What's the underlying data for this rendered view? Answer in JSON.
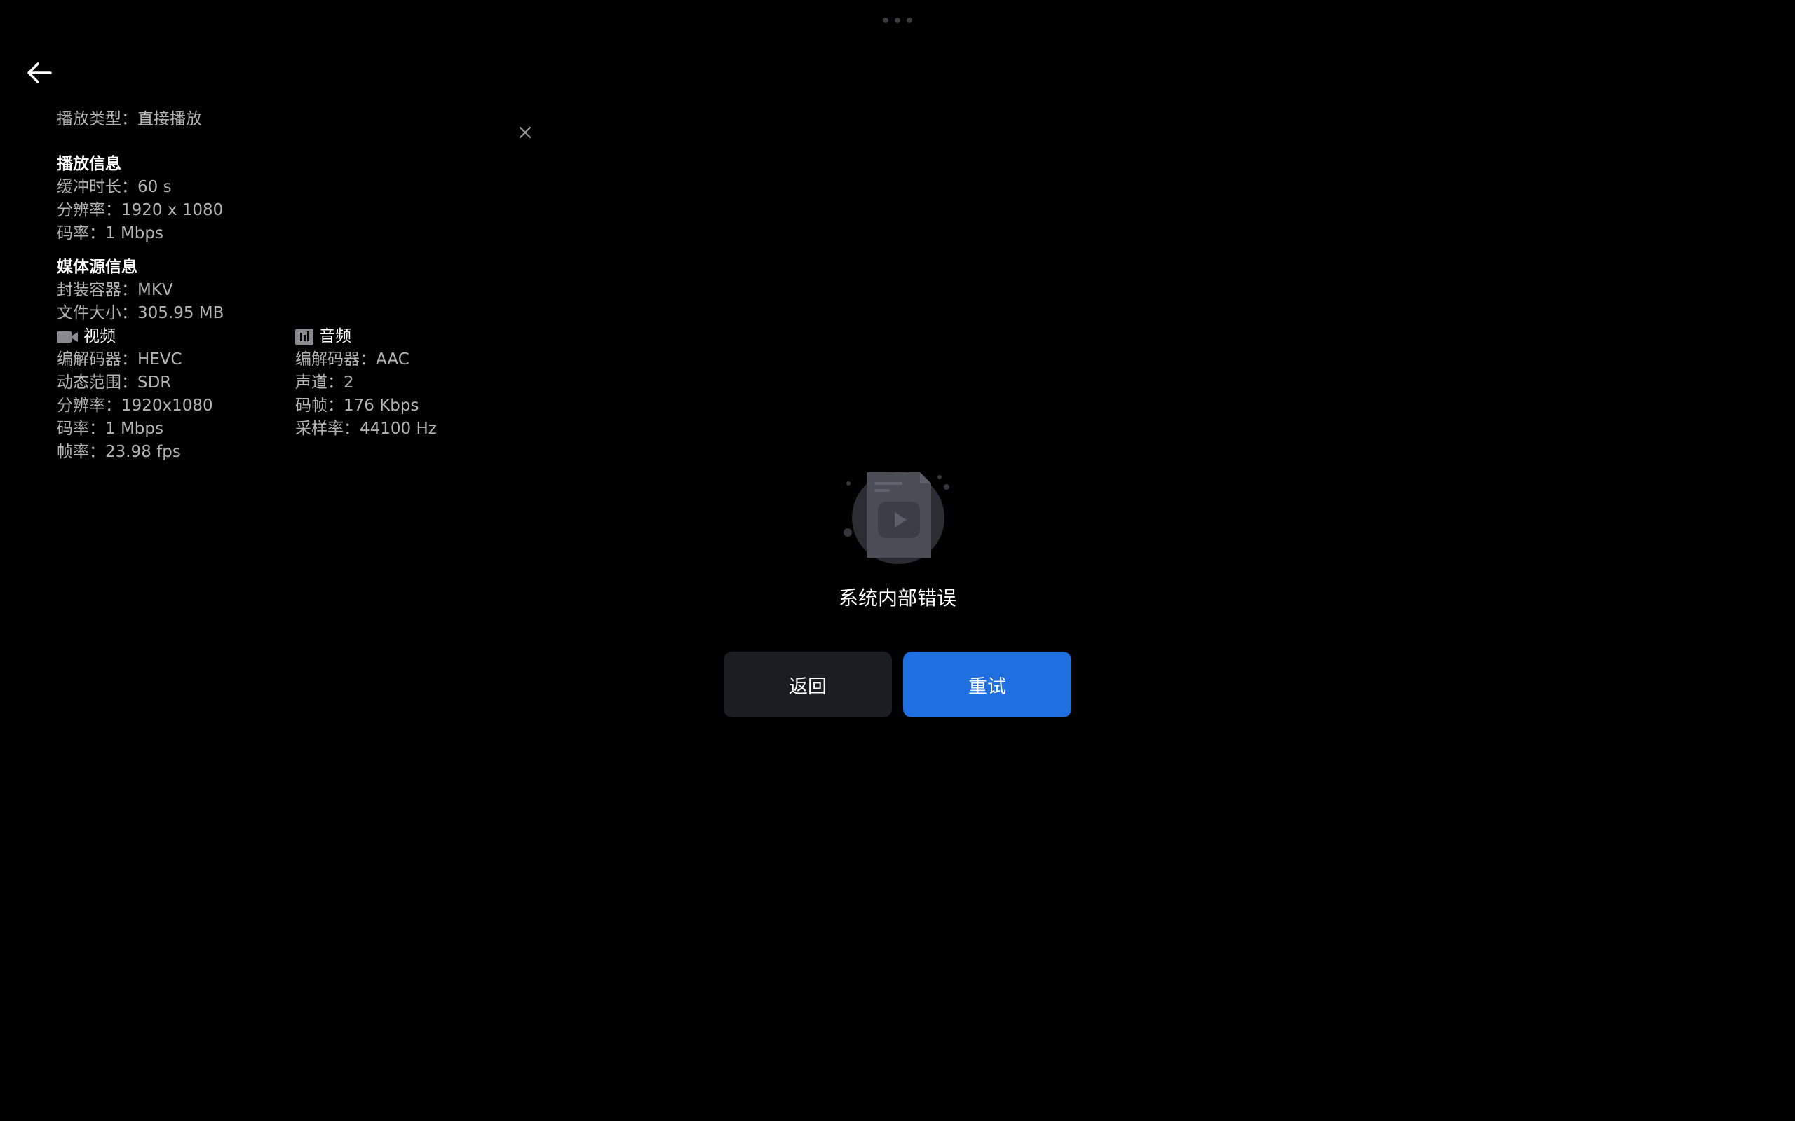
{
  "playback_type": {
    "label": "播放类型：",
    "value": "直接播放"
  },
  "play_info": {
    "title": "播放信息",
    "rows": [
      {
        "label": "缓冲时长：",
        "value": "60 s"
      },
      {
        "label": "分辨率：",
        "value": "1920 x 1080"
      },
      {
        "label": "码率：",
        "value": "1 Mbps"
      }
    ]
  },
  "media_info": {
    "title": "媒体源信息",
    "rows": [
      {
        "label": "封装容器：",
        "value": "MKV"
      },
      {
        "label": "文件大小：",
        "value": "305.95 MB"
      }
    ],
    "video": {
      "title": "视频",
      "icon": "video-camera-icon",
      "rows": [
        {
          "label": "编解码器：",
          "value": "HEVC"
        },
        {
          "label": "动态范围：",
          "value": "SDR"
        },
        {
          "label": "分辨率：",
          "value": "1920x1080"
        },
        {
          "label": "码率：",
          "value": "1 Mbps"
        },
        {
          "label": "帧率：",
          "value": "23.98 fps"
        }
      ]
    },
    "audio": {
      "title": "音频",
      "icon": "audio-bars-icon",
      "rows": [
        {
          "label": "编解码器：",
          "value": "AAC"
        },
        {
          "label": "声道：",
          "value": "2"
        },
        {
          "label": "码帧：",
          "value": "176 Kbps"
        },
        {
          "label": "采样率：",
          "value": "44100 Hz"
        }
      ]
    }
  },
  "error": {
    "message": "系统内部错误",
    "back_label": "返回",
    "retry_label": "重试"
  },
  "colors": {
    "background": "#000000",
    "retry_button": "#1f6fe0",
    "back_button": "#1c1d21"
  }
}
